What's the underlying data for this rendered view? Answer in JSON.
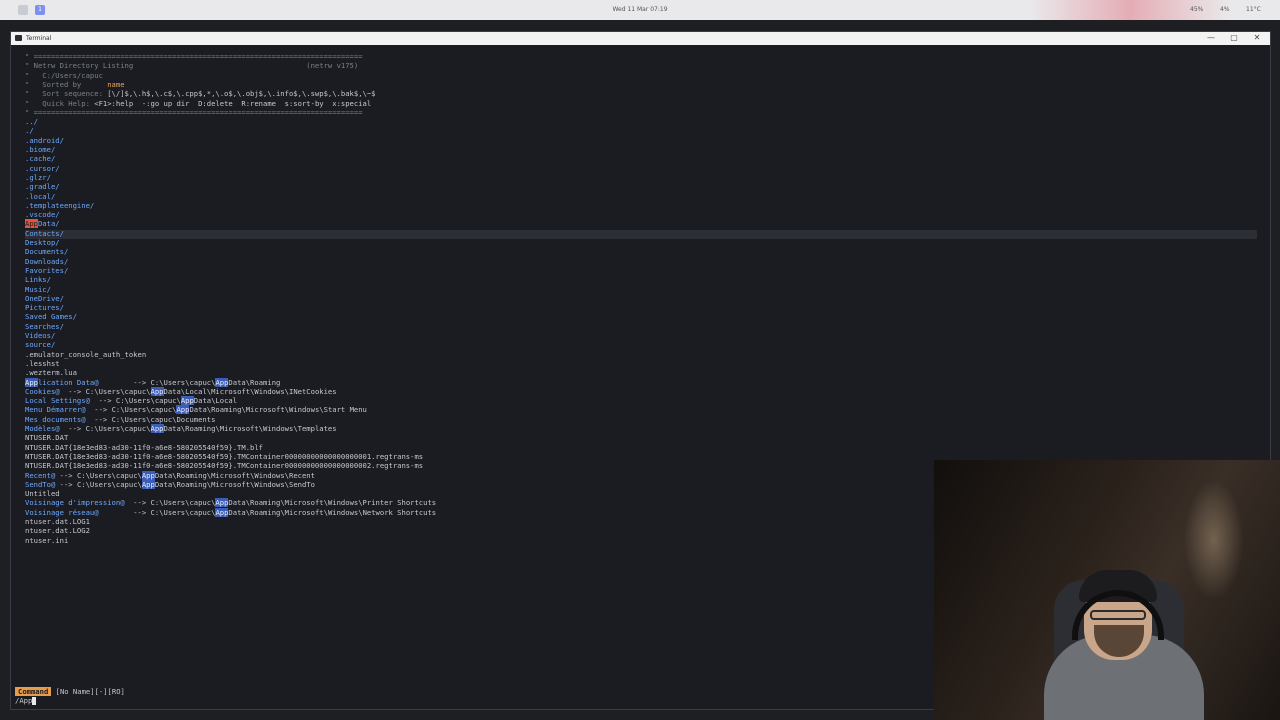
{
  "topbar": {
    "workspaces": [
      "",
      "1"
    ],
    "clock": "Wed 11 Mar 07:19",
    "tray": [
      "45%",
      "4%",
      "11°C"
    ]
  },
  "window": {
    "title": "Terminal",
    "buttons": [
      "—",
      "▢",
      "✕"
    ]
  },
  "netrw": {
    "rule": "\" ============================================================================",
    "header": [
      {
        "text": "\" Netrw Directory Listing                                        ",
        "extra": "(netrw v175)"
      },
      {
        "text": "\"   C:/Users/capuc",
        "extra": ""
      },
      {
        "text": "\"   Sorted by      ",
        "extra": "name"
      },
      {
        "text": "\"   Sort sequence: ",
        "extra": "[\\/]$,\\.h$,\\.c$,\\.cpp$,*,\\.o$,\\.obj$,\\.info$,\\.swp$,\\.bak$,\\~$"
      },
      {
        "text": "\"   Quick Help: ",
        "extra": "<F1>:help  -:go up dir  D:delete  R:rename  s:sort-by  x:special"
      }
    ],
    "entries": [
      {
        "type": "dir",
        "name": "../"
      },
      {
        "type": "dir",
        "name": "./"
      },
      {
        "type": "dir",
        "name": ".android/"
      },
      {
        "type": "dir",
        "name": ".biome/"
      },
      {
        "type": "dir",
        "name": ".cache/"
      },
      {
        "type": "dir",
        "name": ".cursor/"
      },
      {
        "type": "dir",
        "name": ".glzr/"
      },
      {
        "type": "dir",
        "name": ".gradle/"
      },
      {
        "type": "dir",
        "name": ".local/"
      },
      {
        "type": "dir",
        "name": ".templateengine/"
      },
      {
        "type": "dir",
        "name": ".vscode/"
      },
      {
        "type": "dir",
        "name": "AppData/",
        "cursor": "App",
        "rest": "Data/"
      },
      {
        "type": "dir",
        "name": "Contacts/"
      },
      {
        "type": "dir",
        "name": "Desktop/"
      },
      {
        "type": "dir",
        "name": "Documents/"
      },
      {
        "type": "dir",
        "name": "Downloads/"
      },
      {
        "type": "dir",
        "name": "Favorites/"
      },
      {
        "type": "dir",
        "name": "Links/"
      },
      {
        "type": "dir",
        "name": "Music/"
      },
      {
        "type": "dir",
        "name": "OneDrive/"
      },
      {
        "type": "dir",
        "name": "Pictures/"
      },
      {
        "type": "dir",
        "name": "Saved Games/"
      },
      {
        "type": "dir",
        "name": "Searches/"
      },
      {
        "type": "dir",
        "name": "Videos/"
      },
      {
        "type": "dir",
        "name": "source/"
      },
      {
        "type": "file",
        "name": ".emulator_console_auth_token"
      },
      {
        "type": "file",
        "name": ".lesshst"
      },
      {
        "type": "file",
        "name": ".wezterm.lua"
      },
      {
        "type": "link",
        "pre": "",
        "match": "App",
        "post": "lication Data@",
        "pad": "        ",
        "arrow": "--> ",
        "tpre": "C:\\Users\\capuc\\",
        "tmatch": "App",
        "tpost": "Data\\Roaming"
      },
      {
        "type": "link",
        "pre": "Cookies@",
        "match": "",
        "post": "",
        "pad": "  ",
        "arrow": "--> ",
        "tpre": "C:\\Users\\capuc\\",
        "tmatch": "App",
        "tpost": "Data\\Local\\Microsoft\\Windows\\INetCookies"
      },
      {
        "type": "link",
        "pre": "Local Settings@",
        "match": "",
        "post": "",
        "pad": "  ",
        "arrow": "--> ",
        "tpre": "C:\\Users\\capuc\\",
        "tmatch": "App",
        "tpost": "Data\\Local"
      },
      {
        "type": "link",
        "pre": "Menu Démarrer@",
        "match": "",
        "post": "",
        "pad": "  ",
        "arrow": "--> ",
        "tpre": "C:\\Users\\capuc\\",
        "tmatch": "App",
        "tpost": "Data\\Roaming\\Microsoft\\Windows\\Start Menu"
      },
      {
        "type": "link",
        "pre": "Mes documents@",
        "match": "",
        "post": "",
        "pad": "  ",
        "arrow": "--> ",
        "tpre": "C:\\Users\\capuc\\Documents",
        "tmatch": "",
        "tpost": ""
      },
      {
        "type": "link",
        "pre": "Modèles@",
        "match": "",
        "post": "",
        "pad": "  ",
        "arrow": "--> ",
        "tpre": "C:\\Users\\capuc\\",
        "tmatch": "App",
        "tpost": "Data\\Roaming\\Microsoft\\Windows\\Templates"
      },
      {
        "type": "file",
        "name": "NTUSER.DAT"
      },
      {
        "type": "file",
        "name": "NTUSER.DAT{18e3ed83-ad30-11f0-a6e8-580205540f59}.TM.blf"
      },
      {
        "type": "file",
        "name": "NTUSER.DAT{18e3ed83-ad30-11f0-a6e8-580205540f59}.TMContainer00000000000000000001.regtrans-ms"
      },
      {
        "type": "file",
        "name": "NTUSER.DAT{18e3ed83-ad30-11f0-a6e8-580205540f59}.TMContainer00000000000000000002.regtrans-ms"
      },
      {
        "type": "link",
        "pre": "Recent@",
        "match": "",
        "post": "",
        "pad": " ",
        "arrow": "--> ",
        "tpre": "C:\\Users\\capuc\\",
        "tmatch": "App",
        "tpost": "Data\\Roaming\\Microsoft\\Windows\\Recent"
      },
      {
        "type": "link",
        "pre": "SendTo@",
        "match": "",
        "post": "",
        "pad": " ",
        "arrow": "--> ",
        "tpre": "C:\\Users\\capuc\\",
        "tmatch": "App",
        "tpost": "Data\\Roaming\\Microsoft\\Windows\\SendTo"
      },
      {
        "type": "file",
        "name": "Untitled"
      },
      {
        "type": "link",
        "pre": "Voisinage d'impression@",
        "match": "",
        "post": "",
        "pad": "  ",
        "arrow": "--> ",
        "tpre": "C:\\Users\\capuc\\",
        "tmatch": "App",
        "tpost": "Data\\Roaming\\Microsoft\\Windows\\Printer Shortcuts"
      },
      {
        "type": "link",
        "pre": "Voisinage réseau@",
        "match": "",
        "post": "",
        "pad": "        ",
        "arrow": "--> ",
        "tpre": "C:\\Users\\capuc\\",
        "tmatch": "App",
        "tpost": "Data\\Roaming\\Microsoft\\Windows\\Network Shortcuts"
      },
      {
        "type": "file",
        "name": "ntuser.dat.LOG1"
      },
      {
        "type": "file",
        "name": "ntuser.dat.LOG2"
      },
      {
        "type": "file",
        "name": "ntuser.ini"
      }
    ]
  },
  "statusline": {
    "mode": "Command",
    "buffer": "[No Name][-][RO]"
  },
  "cmdline": {
    "text": "/App"
  },
  "colors": {
    "directory": "#6ea8ff",
    "search_match": "#3b5db8",
    "cursor": "#e2553d",
    "mode_badge": "#e89b4a"
  }
}
